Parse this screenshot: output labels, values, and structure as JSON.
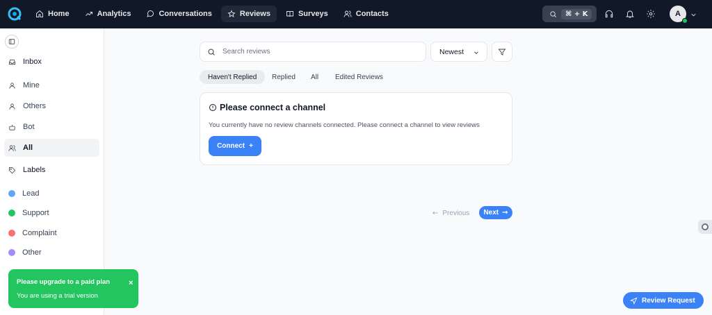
{
  "topnav": {
    "items": [
      {
        "label": "Home",
        "icon": "home-icon"
      },
      {
        "label": "Analytics",
        "icon": "trending-up-icon"
      },
      {
        "label": "Conversations",
        "icon": "chat-bubble-icon"
      },
      {
        "label": "Reviews",
        "icon": "star-icon",
        "active": true
      },
      {
        "label": "Surveys",
        "icon": "book-open-icon"
      },
      {
        "label": "Contacts",
        "icon": "users-icon"
      }
    ],
    "shortcut": "⌘ + K",
    "avatar_initial": "A"
  },
  "sidebar": {
    "items": [
      {
        "label": "Inbox",
        "icon": "inbox-icon"
      },
      {
        "label": "Mine",
        "icon": "user-icon"
      },
      {
        "label": "Others",
        "icon": "user-icon"
      },
      {
        "label": "Bot",
        "icon": "bot-icon"
      },
      {
        "label": "All",
        "icon": "users-icon",
        "active": true
      },
      {
        "label": "Labels",
        "icon": "tag-icon"
      }
    ],
    "labels": [
      {
        "label": "Lead",
        "color": "#60a5fa"
      },
      {
        "label": "Support",
        "color": "#22c55e"
      },
      {
        "label": "Complaint",
        "color": "#f87171"
      },
      {
        "label": "Other",
        "color": "#a78bfa"
      }
    ]
  },
  "toast": {
    "title": "Please upgrade to a paid plan",
    "subtitle": "You are using a trial version",
    "close": "×"
  },
  "reviews": {
    "search_placeholder": "Search reviews",
    "sort_value": "Newest",
    "tabs": [
      "Haven't Replied",
      "Replied",
      "All",
      "Edited Reviews"
    ],
    "card": {
      "title": "Please connect a channel",
      "text": "You currently have no review channels connected. Please connect a channel to view reviews",
      "button": "Connect",
      "button_icon": "+"
    },
    "pagination": {
      "prev": "Previous",
      "next": "Next"
    },
    "review_request": "Review Request"
  },
  "colors": {
    "accent": "#3b82f6",
    "topbar": "#111827",
    "toast": "#22c55e"
  }
}
